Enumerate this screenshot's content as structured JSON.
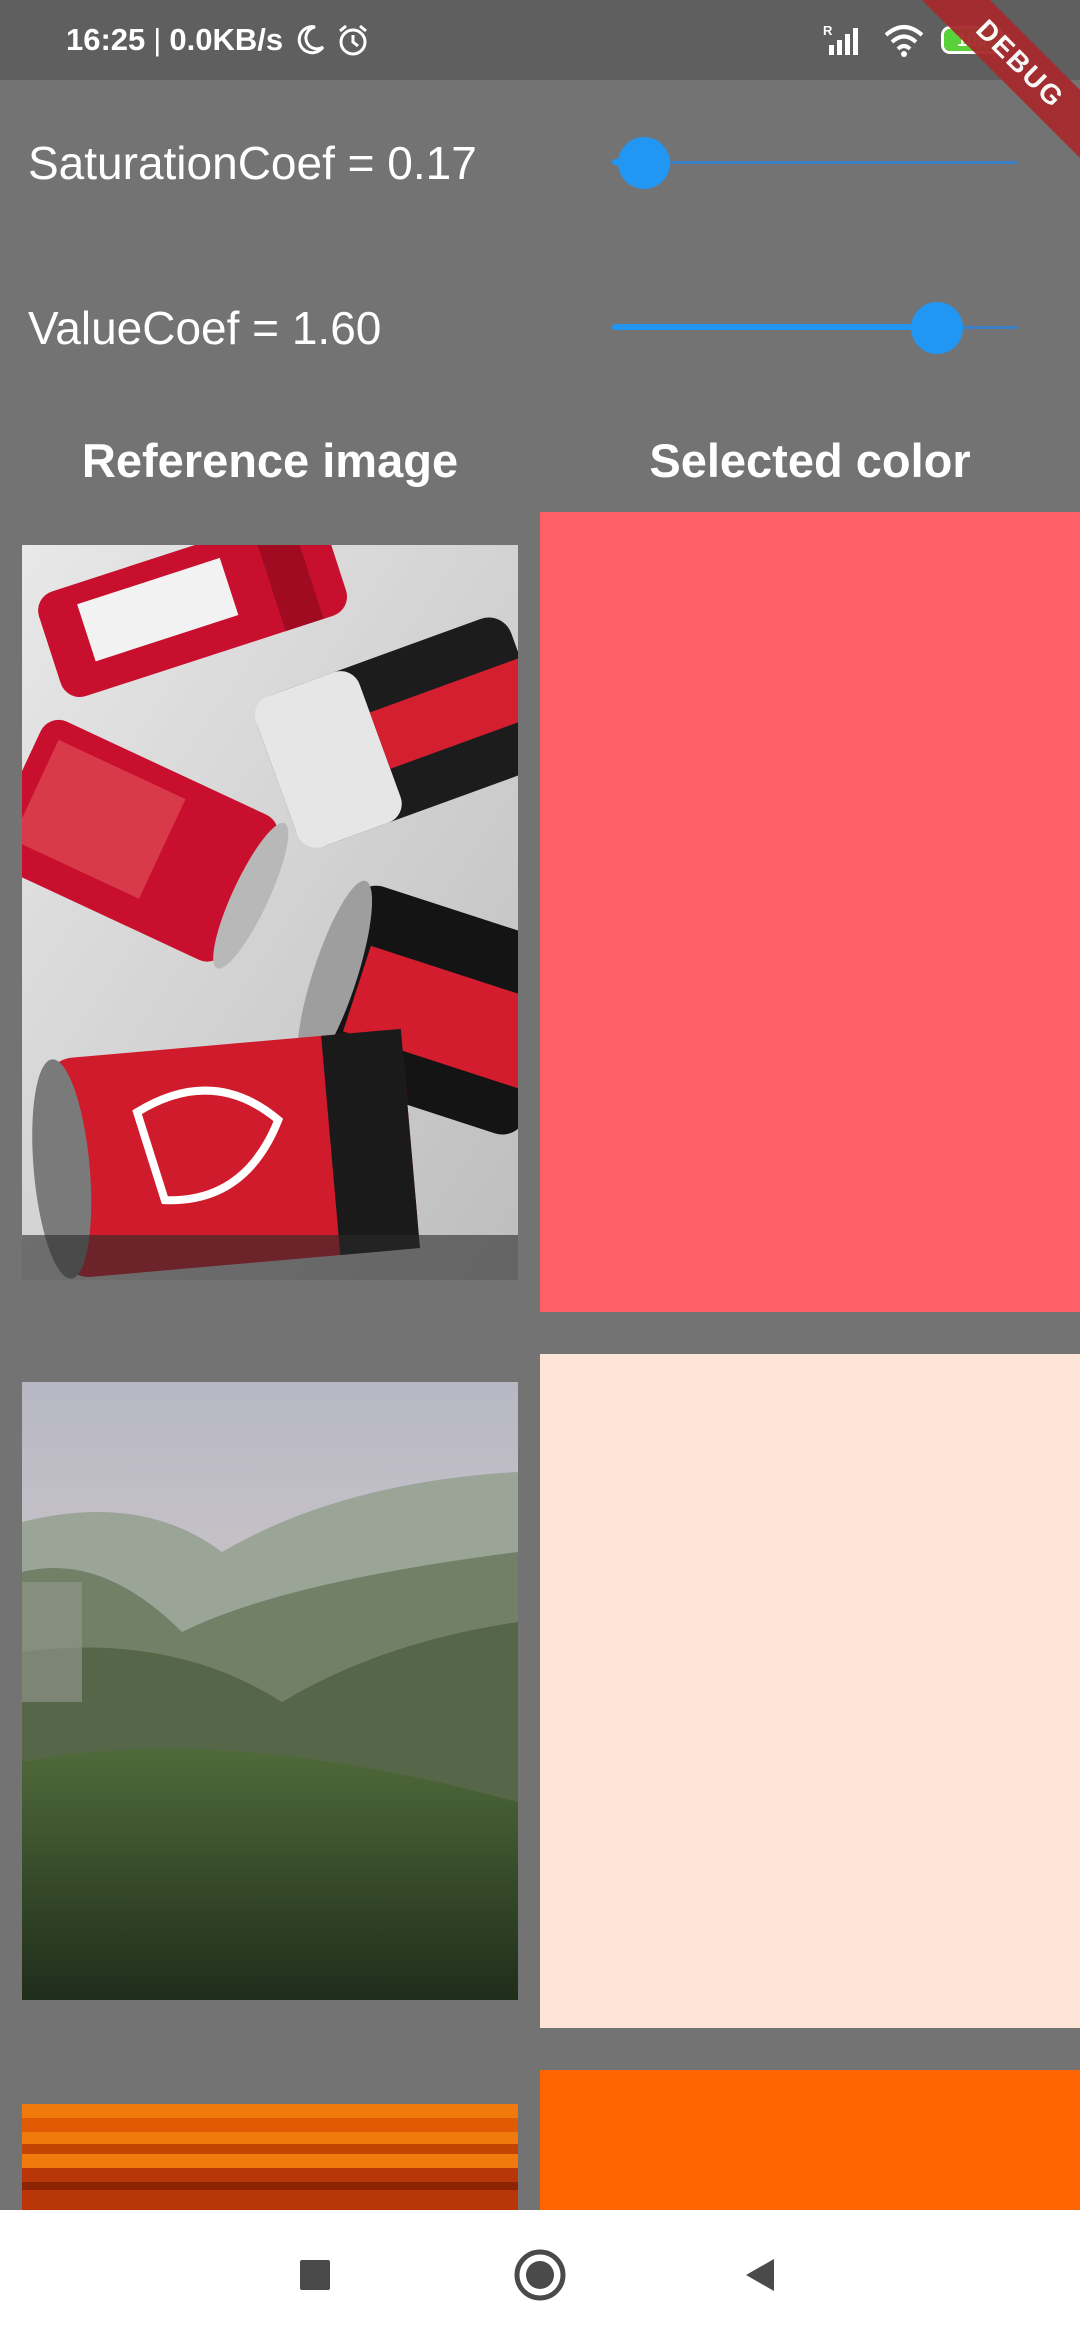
{
  "status_bar": {
    "time": "16:25",
    "separator": "|",
    "net_speed": "0.0KB/s",
    "battery_level": "100",
    "icons": [
      "moon-icon",
      "alarm-icon",
      "signal-icon",
      "wifi-icon",
      "battery-icon"
    ]
  },
  "debug_banner": "DEBUG",
  "sliders": {
    "saturation": {
      "label": "SaturationCoef = 0.17",
      "fraction": 0.08
    },
    "value": {
      "label": "ValueCoef = 1.60",
      "fraction": 0.8
    }
  },
  "headers": {
    "reference": "Reference image",
    "selected": "Selected color"
  },
  "rows": [
    {
      "image": "coca-cola cans",
      "color": "#ff5f66"
    },
    {
      "image": "mountain valley landscape",
      "color": "#fde4d6"
    },
    {
      "image": "orange striped surface",
      "color": "#ff6400"
    }
  ],
  "colors": {
    "background": "#737373",
    "accent": "#2196f3",
    "status_bar": "#5f5f5f",
    "debug_banner": "#a62a2e"
  },
  "nav_bar": {
    "icons": [
      "recents-square-icon",
      "home-circle-icon",
      "back-triangle-icon"
    ]
  }
}
